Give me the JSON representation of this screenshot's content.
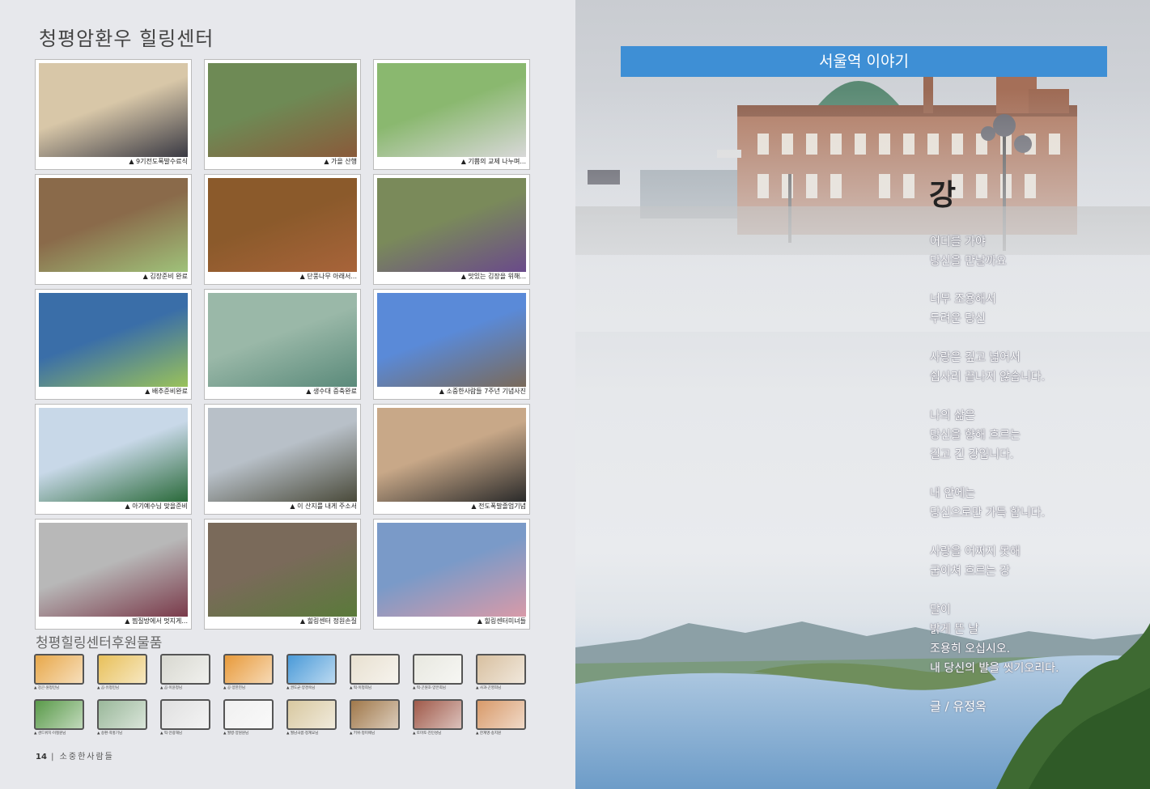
{
  "left_page": {
    "title": "청평암환우 힐링센터",
    "photos": [
      {
        "caption": "▲ 9기전도폭발수료식",
        "colors": [
          "#d8c7a8",
          "#3a3a44"
        ]
      },
      {
        "caption": "▲ 가을 산행",
        "colors": [
          "#6e8a55",
          "#8a5a3a"
        ]
      },
      {
        "caption": "▲ 기쁨의 교제 나누며...",
        "colors": [
          "#8ab86f",
          "#d8d8d8"
        ]
      },
      {
        "caption": "▲ 김장준비 완료",
        "colors": [
          "#8a6a4a",
          "#9fc27a"
        ]
      },
      {
        "caption": "▲ 단풍나무 아래서...",
        "colors": [
          "#8b5a2b",
          "#a8643a"
        ]
      },
      {
        "caption": "▲ 맛있는 김장을 위해...",
        "colors": [
          "#7a8a5a",
          "#6a4a8a"
        ]
      },
      {
        "caption": "▲ 배추준비완료",
        "colors": [
          "#3a6ea8",
          "#9ac25a"
        ]
      },
      {
        "caption": "▲ 생수대 증축완료",
        "colors": [
          "#9ab8a8",
          "#5a8a7a"
        ]
      },
      {
        "caption": "▲ 소중한사람들 7주년 기념사진",
        "colors": [
          "#5a8ad8",
          "#7a6a5a"
        ]
      },
      {
        "caption": "▲ 아기예수님 맞을준비",
        "colors": [
          "#c8d8e8",
          "#2a6a3a"
        ]
      },
      {
        "caption": "▲ 이 산지를 내게 주소서",
        "colors": [
          "#b8c0c8",
          "#4a4a3a"
        ]
      },
      {
        "caption": "▲ 전도폭발졸업기념",
        "colors": [
          "#c8a888",
          "#2a2a2a"
        ]
      },
      {
        "caption": "▲ 찜질방에서 멋지게...",
        "colors": [
          "#b8b8b8",
          "#7a3a4a"
        ]
      },
      {
        "caption": "▲ 힐링센터 정원손질",
        "colors": [
          "#7a6a5a",
          "#5a7a3a"
        ]
      },
      {
        "caption": "▲ 힐링센터미녀들",
        "colors": [
          "#7a9ac8",
          "#d89aa8"
        ]
      }
    ],
    "donation_title": "청평힐링센터후원물품",
    "gifts_row1": [
      {
        "caption": "▲ 강곤·원정민님",
        "color": "#e8a84a"
      },
      {
        "caption": "▲ 곰·유정민님",
        "color": "#e8c05a"
      },
      {
        "caption": "▲ 곰·이윤정님",
        "color": "#d8d8d0"
      },
      {
        "caption": "▲ 공·양한진님",
        "color": "#e89a3a"
      },
      {
        "caption": "▲ 권도균·양경숙님",
        "color": "#4a9ad8"
      },
      {
        "caption": "▲ 떡·이정희님",
        "color": "#e8e0d0"
      },
      {
        "caption": "▲ 떡·곤원호·양은희님",
        "color": "#e8e8e0"
      },
      {
        "caption": "▲ 사과·곤영희님",
        "color": "#d8c0a0"
      }
    ],
    "gifts_row2": [
      {
        "caption": "▲ 샌드위치·이철원님",
        "color": "#5a9a4a"
      },
      {
        "caption": "▲ 송편·곽홍기님",
        "color": "#9ab89a"
      },
      {
        "caption": "▲ 떡·안광해님",
        "color": "#e0e0e0"
      },
      {
        "caption": "▲ 월병·양원원님",
        "color": "#f0f0f0"
      },
      {
        "caption": "▲ 월남국쌈·정계요님",
        "color": "#d8c8a0"
      },
      {
        "caption": "▲ 키위·정미애님",
        "color": "#a0784a"
      },
      {
        "caption": "▲ 토마토·진인성님",
        "color": "#a05a4a"
      },
      {
        "caption": "▲ 한계명·송지원",
        "color": "#d89a6a"
      }
    ],
    "footer_page": "14",
    "footer_text": "소중한사람들"
  },
  "right_page": {
    "banner": "서울역 이야기",
    "poem_title": "강",
    "stanzas": [
      [
        "어디를 가야",
        "당신을 만날까요"
      ],
      [
        "너무 조용해서",
        "두려운 당신"
      ],
      [
        "사랑은 깊고 넓어서",
        "쉽사리 끝나지 않습니다."
      ],
      [
        "나의 삶은",
        "당신을 향해 흐르는",
        "길고 긴 강입니다."
      ],
      [
        "내 안에는",
        "당신으로만 가득 합니다."
      ],
      [
        "사랑을 어쩌지 못해",
        "굽이쳐 흐르는 강"
      ],
      [
        "달이",
        "밝게 뜬 날",
        "조용히 오십시오.",
        "내 당신의 발을 씻기오리다."
      ]
    ],
    "author": "글 / 유정옥",
    "colors": {
      "banner": "#3e8fd5",
      "station_brick": "#b07a62",
      "water": "#7fa9cf"
    }
  }
}
